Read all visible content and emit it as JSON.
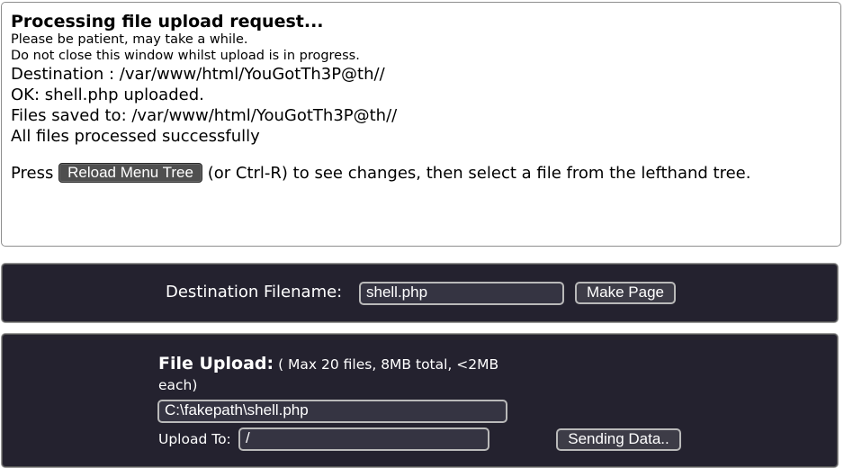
{
  "status": {
    "title": "Processing file upload request...",
    "note_1": "Please be patient, may take a while.",
    "note_2": "Do not close this window whilst upload is in progress.",
    "destination": "Destination : /var/www/html/YouGotTh3P@th//",
    "ok_message": "OK: shell.php uploaded.",
    "saved_to": "Files saved to: /var/www/html/YouGotTh3P@th//",
    "all_processed": "All files processed successfully",
    "press_prefix": "Press",
    "reload_button_label": "Reload Menu Tree",
    "press_suffix": "(or Ctrl-R) to see changes, then select a file from the lefthand tree."
  },
  "destination_form": {
    "label": "Destination Filename:",
    "filename_value": "shell.php",
    "make_page_label": "Make Page"
  },
  "upload_form": {
    "heading": "File Upload:",
    "limits": "( Max 20 files, 8MB total, <2MB each)",
    "file_path_value": "C:\\fakepath\\shell.php",
    "upload_to_label": "Upload To:",
    "upload_to_value": "/",
    "sending_label": "Sending Data.."
  }
}
